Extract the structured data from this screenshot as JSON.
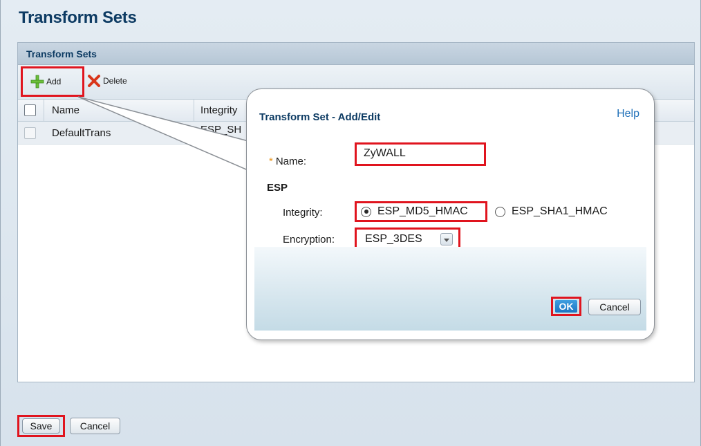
{
  "page": {
    "title": "Transform Sets"
  },
  "panel": {
    "header": "Transform Sets"
  },
  "toolbar": {
    "add_label": "Add",
    "delete_label": "Delete"
  },
  "grid": {
    "columns": [
      "Name",
      "Integrity"
    ],
    "rows": [
      {
        "name": "DefaultTrans",
        "integrity": "ESP_SH"
      }
    ]
  },
  "dialog": {
    "title": "Transform Set - Add/Edit",
    "help_label": "Help",
    "name_label": "Name:",
    "required_marker": "*",
    "name_value": "ZyWALL",
    "esp_label": "ESP",
    "integrity_label": "Integrity:",
    "integrity_options": [
      "ESP_MD5_HMAC",
      "ESP_SHA1_HMAC"
    ],
    "integrity_selected": "ESP_MD5_HMAC",
    "encryption_label": "Encryption:",
    "encryption_value": "ESP_3DES",
    "ok_label": "OK",
    "cancel_label": "Cancel"
  },
  "footer": {
    "save_label": "Save",
    "cancel_label": "Cancel"
  },
  "colors": {
    "highlight": "#e0141e",
    "title": "#0d3b63",
    "link": "#1e6fb8",
    "ok_button": "#1c74c2"
  }
}
